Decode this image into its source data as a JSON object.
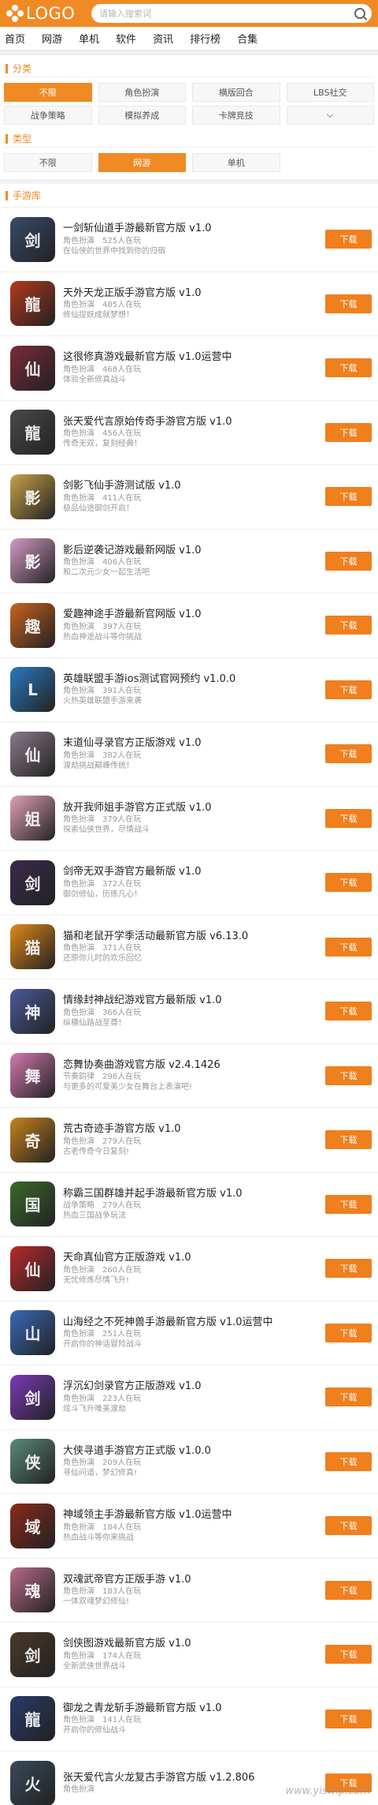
{
  "header": {
    "logo_text": "LOGO",
    "search_placeholder": "请输入搜索词"
  },
  "nav": [
    "首页",
    "网游",
    "单机",
    "软件",
    "资讯",
    "排行榜",
    "合集"
  ],
  "filters": {
    "category_title": "分类",
    "categories": [
      {
        "label": "不限",
        "active": true
      },
      {
        "label": "角色扮演",
        "active": false
      },
      {
        "label": "横版回合",
        "active": false
      },
      {
        "label": "LBS社交",
        "active": false
      },
      {
        "label": "战争策略",
        "active": false
      },
      {
        "label": "模拟养成",
        "active": false
      },
      {
        "label": "卡牌竞技",
        "active": false
      }
    ],
    "type_title": "类型",
    "types": [
      {
        "label": "不限",
        "active": false
      },
      {
        "label": "网游",
        "active": true
      },
      {
        "label": "单机",
        "active": false
      }
    ]
  },
  "list": {
    "title": "手游库",
    "download_label": "下载",
    "games": [
      {
        "name": "一剑斩仙道手游最新官方版 v1.0",
        "genre": "角色扮演",
        "online": "525人在玩",
        "desc": "在仙侠的世界中找到你的归宿",
        "color": "#3a4a6b",
        "glyph": "剑"
      },
      {
        "name": "天外天龙正版手游官方版 v1.0",
        "genre": "角色扮演",
        "online": "485人在玩",
        "desc": "修仙捉妖成就梦想！",
        "color": "#b23a1c",
        "glyph": "龍"
      },
      {
        "name": "这很修真游戏最新官方版 v1.0运营中",
        "genre": "角色扮演",
        "online": "468人在玩",
        "desc": "体验全新修真战斗",
        "color": "#7a2a3a",
        "glyph": "仙"
      },
      {
        "name": "张天爱代言原始传奇手游官方版 v1.0",
        "genre": "角色扮演",
        "online": "456人在玩",
        "desc": "传奇无双，复刻经典！",
        "color": "#4a4a4a",
        "glyph": "龍"
      },
      {
        "name": "剑影飞仙手游测试版 v1.0",
        "genre": "角色扮演",
        "online": "411人在玩",
        "desc": "极品仙途御剑开启！",
        "color": "#c9a24a",
        "glyph": "影"
      },
      {
        "name": "影后逆袭记游戏最新网版 v1.0",
        "genre": "角色扮演",
        "online": "406人在玩",
        "desc": "和二次元少女一起生活吧",
        "color": "#d49ac4",
        "glyph": "影"
      },
      {
        "name": "爱趣神途手游最新官网版 v1.0",
        "genre": "角色扮演",
        "online": "397人在玩",
        "desc": "热血神途战斗等你挑战",
        "color": "#c8641e",
        "glyph": "趣"
      },
      {
        "name": "英雄联盟手游ios测试官网预约 v1.0.0",
        "genre": "角色扮演",
        "online": "391人在玩",
        "desc": "火热英雄联盟手游来袭",
        "color": "#2a7ac0",
        "glyph": "L"
      },
      {
        "name": "末道仙寻录官方正版游戏 v1.0",
        "genre": "角色扮演",
        "online": "382人在玩",
        "desc": "渡劫挑战巅峰传统！",
        "color": "#8a7a8a",
        "glyph": "仙"
      },
      {
        "name": "放开我师姐手游官方正式版 v1.0",
        "genre": "角色扮演",
        "online": "379人在玩",
        "desc": "探索仙侠世界，尽情战斗",
        "color": "#e0a0b8",
        "glyph": "姐"
      },
      {
        "name": "剑帝无双手游官方最新版 v1.0",
        "genre": "角色扮演",
        "online": "372人在玩",
        "desc": "御剑修仙，历练凡心！",
        "color": "#3a2a4a",
        "glyph": "剑"
      },
      {
        "name": "猫和老鼠开学季活动最新官方版 v6.13.0",
        "genre": "角色扮演",
        "online": "371人在玩",
        "desc": "还原你儿时的欢乐回忆",
        "color": "#e08a1a",
        "glyph": "猫"
      },
      {
        "name": "情缘封神战纪游戏官方最新版 v1.0",
        "genre": "角色扮演",
        "online": "366人在玩",
        "desc": "纵横仙路战至尊！",
        "color": "#4a5a9a",
        "glyph": "神"
      },
      {
        "name": "恋舞协奏曲游戏官方版 v2.4.1426",
        "genre": "节奏韵律",
        "online": "296人在玩",
        "desc": "与更多的可爱美少女在舞台上表演吧!",
        "color": "#d47ab0",
        "glyph": "舞"
      },
      {
        "name": "荒古奇迹手游官方版 v1.0",
        "genre": "角色扮演",
        "online": "279人在玩",
        "desc": "古老传奇今日复刻!",
        "color": "#c8821e",
        "glyph": "奇"
      },
      {
        "name": "称霸三国群雄并起手游最新官方版 v1.0",
        "genre": "战争策略",
        "online": "279人在玩",
        "desc": "热血三国战争玩法",
        "color": "#3a6a2a",
        "glyph": "国"
      },
      {
        "name": "天命真仙官方正版游戏 v1.0",
        "genre": "角色扮演",
        "online": "260人在玩",
        "desc": "无忧修炼尽情飞升!",
        "color": "#b82a2a",
        "glyph": "仙"
      },
      {
        "name": "山海经之不死神兽手游最新官方版 v1.0运营中",
        "genre": "角色扮演",
        "online": "251人在玩",
        "desc": "开启你的神话冒险战斗",
        "color": "#3a6ab8",
        "glyph": "山"
      },
      {
        "name": "浮沉幻剑录官方正版游戏 v1.0",
        "genre": "角色扮演",
        "online": "223人在玩",
        "desc": "炫斗飞升唯美渡劫",
        "color": "#7a3ab8",
        "glyph": "剑"
      },
      {
        "name": "大侠寻道手游官方正式版 v1.0.0",
        "genre": "角色扮演",
        "online": "209人在玩",
        "desc": "寻仙问道，梦幻修真!",
        "color": "#5a8a7a",
        "glyph": "侠"
      },
      {
        "name": "神域领主手游最新官方版 v1.0运营中",
        "genre": "角色扮演",
        "online": "184人在玩",
        "desc": "热血战斗等你来挑战",
        "color": "#8a2a1a",
        "glyph": "域"
      },
      {
        "name": "双魂武帝官方正版手游 v1.0",
        "genre": "角色扮演",
        "online": "183人在玩",
        "desc": "一体双魂梦幻修仙!",
        "color": "#b86a8a",
        "glyph": "魂"
      },
      {
        "name": "剑侠图游戏最新官方版 v1.0",
        "genre": "角色扮演",
        "online": "174人在玩",
        "desc": "全新武侠世界战斗",
        "color": "#4a3a2a",
        "glyph": "剑"
      },
      {
        "name": "御龙之青龙斩手游最新官方版 v1.0",
        "genre": "角色扮演",
        "online": "141人在玩",
        "desc": "开启你的修仙战斗",
        "color": "#2a3a6a",
        "glyph": "龍"
      },
      {
        "name": "张天爱代言火龙复古手游官方版 v1.2.806",
        "genre": "角色扮演",
        "online": "",
        "desc": "",
        "color": "#3a4a5a",
        "glyph": "火"
      }
    ]
  },
  "watermark": "www.yiswip.com"
}
